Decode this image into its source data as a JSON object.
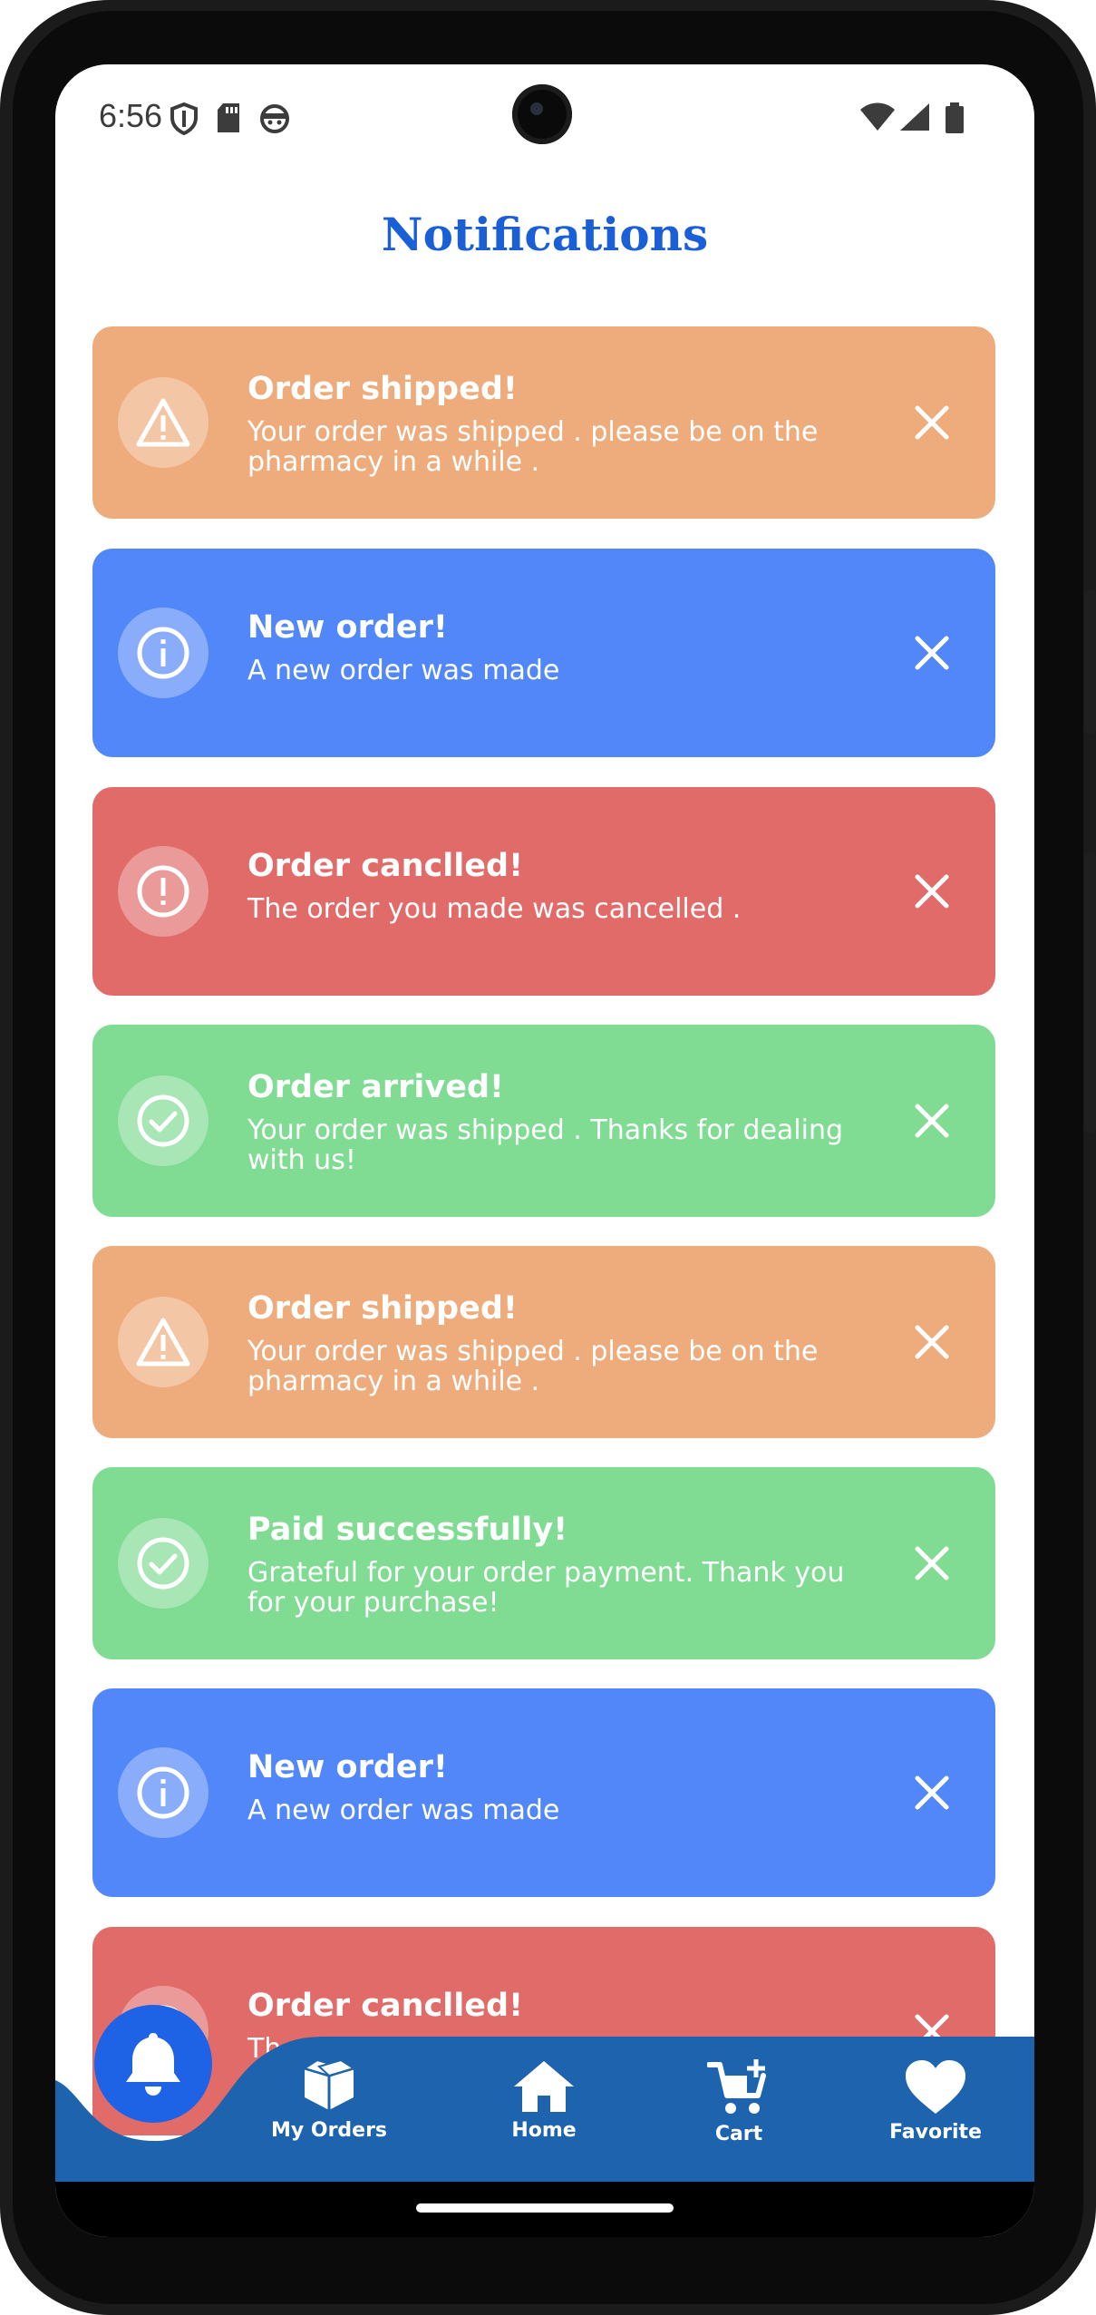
{
  "status_bar": {
    "time": "6:56",
    "left_icons": [
      "shield-icon",
      "sd-card-icon",
      "android-face-icon"
    ],
    "right_icons": [
      "wifi-icon",
      "signal-icon",
      "battery-icon"
    ]
  },
  "page": {
    "title": "Notifications"
  },
  "colors": {
    "warning": "#EEAC7C",
    "info": "#5187F9",
    "error": "#E16B68",
    "success": "#80DB93",
    "title": "#1A5FD6",
    "nav": "#1E63AD",
    "bell": "#1E63E6"
  },
  "notifications": [
    {
      "type": "warning",
      "icon": "warning-triangle-icon",
      "title": "Order shipped!",
      "message": "Your order was shipped . please be on the pharmacy in a while ."
    },
    {
      "type": "info",
      "icon": "info-circle-icon",
      "title": "New order!",
      "message": "A new order was made"
    },
    {
      "type": "error",
      "icon": "error-circle-icon",
      "title": "Order canclled!",
      "message": "The order you made was cancelled ."
    },
    {
      "type": "success",
      "icon": "check-circle-icon",
      "title": "Order arrived!",
      "message": "Your order was shipped . Thanks for dealing with us!"
    },
    {
      "type": "warning",
      "icon": "warning-triangle-icon",
      "title": "Order shipped!",
      "message": "Your order was shipped . please be on the pharmacy in a while ."
    },
    {
      "type": "success",
      "icon": "check-circle-icon",
      "title": "Paid successfully!",
      "message": "Grateful for your order payment. Thank you for your purchase!"
    },
    {
      "type": "info",
      "icon": "info-circle-icon",
      "title": "New order!",
      "message": "A new order was made"
    },
    {
      "type": "error",
      "icon": "error-circle-icon",
      "title": "Order canclled!",
      "message": "Th"
    }
  ],
  "bottom_nav": {
    "active": "notifications",
    "items": [
      {
        "label": "My Orders",
        "icon": "box-icon"
      },
      {
        "label": "Home",
        "icon": "home-icon"
      },
      {
        "label": "Cart",
        "icon": "cart-add-icon"
      },
      {
        "label": "Favorite",
        "icon": "heart-icon"
      }
    ]
  }
}
